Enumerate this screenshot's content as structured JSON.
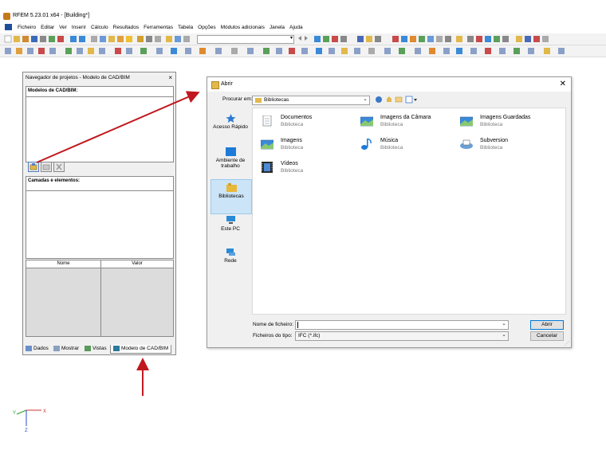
{
  "app": {
    "title": "RFEM 5.23.01 x64 - [Building*]"
  },
  "menu": [
    "Ficheiro",
    "Editar",
    "Ver",
    "Inserir",
    "Cálculo",
    "Resultados",
    "Ferramentas",
    "Tabela",
    "Opções",
    "Módulos adicionais",
    "Janela",
    "Ajuda"
  ],
  "navigator": {
    "title": "Navegador de projetos - Modelo de CAD/BIM",
    "close": "×",
    "models_label": "Modelos de CAD/BIM:",
    "layers_label": "Camadas e elementos:",
    "col_name": "Nome",
    "col_value": "Valor",
    "tabs": [
      "Dados",
      "Mostrar",
      "Vistas",
      "Modelo de CAD/BIM"
    ]
  },
  "dialog": {
    "title": "Abrir",
    "close": "✕",
    "lookin_label": "Procurar em:",
    "lookin_value": "Bibliotecas",
    "places": [
      "Acesso Rápido",
      "Ambiente de trabalho",
      "Bibliotecas",
      "Este PC",
      "Rede"
    ],
    "selected_place": "Bibliotecas",
    "items": [
      {
        "name": "Documentos",
        "sub": "Biblioteca",
        "icon": "documents-library-icon"
      },
      {
        "name": "Imagens da Câmara",
        "sub": "Biblioteca",
        "icon": "camera-roll-library-icon"
      },
      {
        "name": "Imagens Guardadas",
        "sub": "Biblioteca",
        "icon": "saved-pictures-library-icon"
      },
      {
        "name": "Imagens",
        "sub": "Biblioteca",
        "icon": "pictures-library-icon"
      },
      {
        "name": "Música",
        "sub": "Biblioteca",
        "icon": "music-library-icon"
      },
      {
        "name": "Subversion",
        "sub": "Biblioteca",
        "icon": "subversion-library-icon"
      },
      {
        "name": "Vídeos",
        "sub": "Biblioteca",
        "icon": "videos-library-icon"
      }
    ],
    "filename_label": "Nome de ficheiro:",
    "filename_value": "",
    "filetype_label": "Ficheiros do tipo:",
    "filetype_value": "IFC (*.ifc)",
    "open_button": "Abrir",
    "cancel_button": "Cancelar"
  },
  "axes": {
    "x": "X",
    "y": "Y",
    "z": "Z"
  },
  "colors": {
    "arrow": "#c0181e",
    "selection": "#cce4f7",
    "axis_x": "#d03030",
    "axis_y": "#2a9a2a",
    "axis_z": "#2a4ad0"
  }
}
